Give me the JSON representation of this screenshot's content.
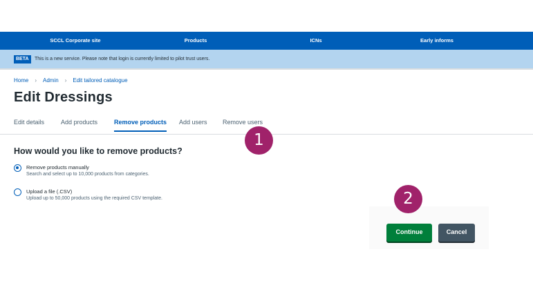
{
  "topnav": {
    "items": [
      "SCCL Corporate site",
      "Products",
      "ICNs",
      "Early informs"
    ]
  },
  "beta": {
    "tag": "BETA",
    "text": "This is a new service. Please note that login is currently limited to pilot trust users."
  },
  "breadcrumb": {
    "items": [
      "Home",
      "Admin",
      "Edit tailored catalogue"
    ],
    "separator": "›"
  },
  "page": {
    "title": "Edit Dressings"
  },
  "tabs": {
    "items": [
      "Edit details",
      "Add products",
      "Remove products",
      "Add users",
      "Remove users"
    ],
    "active": "Remove products"
  },
  "form": {
    "question": "How would you like to remove products?",
    "options": [
      {
        "label": "Remove products manually",
        "hint": "Search and select up to 10,000 products from categories.",
        "checked": true
      },
      {
        "label": "Upload a file (.CSV)",
        "hint": "Upload up to 50,000 products using the required CSV template.",
        "checked": false
      }
    ]
  },
  "actions": {
    "continue_label": "Continue",
    "cancel_label": "Cancel"
  },
  "markers": [
    "1",
    "2"
  ],
  "colors": {
    "brand_blue": "#005eb8",
    "beta_banner": "#b3d4ef",
    "continue_green": "#007f3b",
    "cancel_grey": "#425563",
    "marker": "#a0226a"
  }
}
